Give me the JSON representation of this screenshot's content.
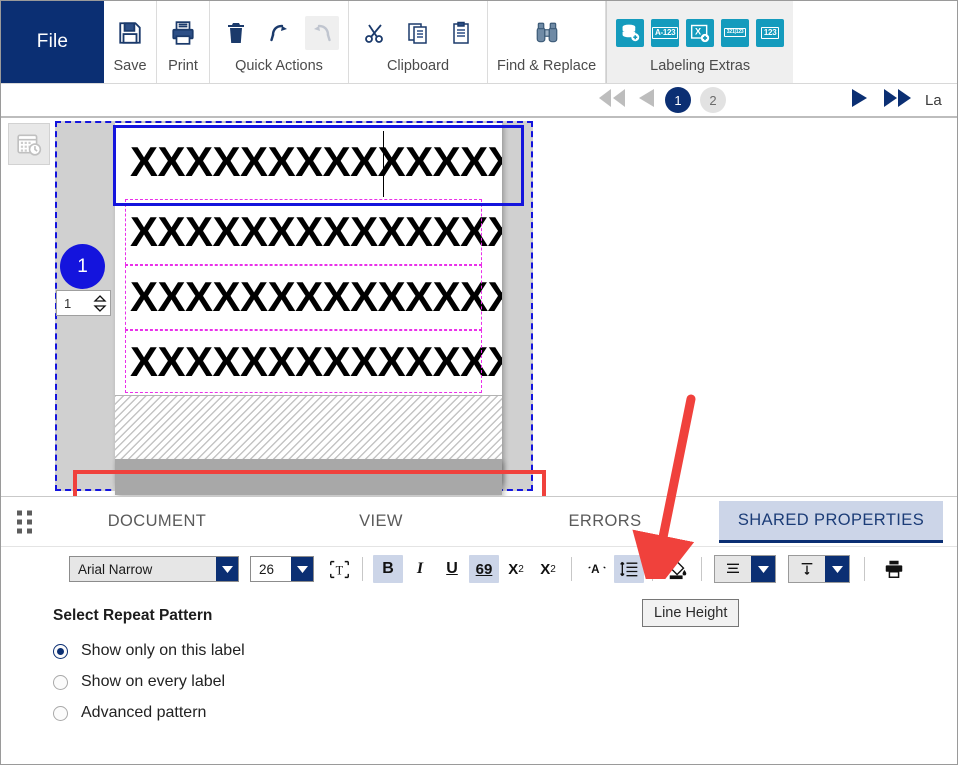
{
  "ribbon": {
    "file_label": "File",
    "groups": [
      {
        "label": "Save",
        "icons": [
          "floppy-disk-icon"
        ]
      },
      {
        "label": "Print",
        "icons": [
          "printer-icon"
        ]
      },
      {
        "label": "Quick Actions",
        "icons": [
          "trash-icon",
          "undo-icon",
          "redo-icon"
        ]
      },
      {
        "label": "Clipboard",
        "icons": [
          "scissors-icon",
          "copy-icon",
          "paste-icon"
        ]
      },
      {
        "label": "Find & Replace",
        "icons": [
          "binoculars-icon"
        ]
      },
      {
        "label": "Labeling Extras",
        "icons": [
          "database-add-icon",
          "alphanumeric-counter-icon",
          "object-add-icon",
          "mixed-text-icon",
          "number-counter-icon"
        ]
      }
    ],
    "extras_icon_texts": [
      "",
      "A-123",
      "X",
      "321|123",
      "123"
    ]
  },
  "navbar": {
    "first_page_label": "first-page",
    "prev_page_label": "previous-page",
    "pages": [
      {
        "number": "1",
        "active": true
      },
      {
        "number": "2",
        "active": false
      }
    ],
    "next_page_label": "next-page",
    "last_page_label": "last-page",
    "edge_text": "La"
  },
  "canvas": {
    "datetime_button": "date-time-insert",
    "object_badge": "1",
    "spinner_value": "1",
    "label_lines": [
      "XXXXXXXXXXXXXXXXX",
      "XXXXXXXXXXXXXXXXX",
      "XXXXXXXXXXXXXXXXX",
      "XXXXXXXXXXXXXXXXX"
    ]
  },
  "tabs": [
    {
      "label": "DOCUMENT",
      "active": false
    },
    {
      "label": "VIEW",
      "active": false
    },
    {
      "label": "ERRORS",
      "active": false
    },
    {
      "label": "SHARED PROPERTIES",
      "active": true
    }
  ],
  "format_toolbar": {
    "font_name": "Arial Narrow",
    "font_size": "26",
    "fit_text_label": "fit-text-to-box",
    "bold_label": "B",
    "italic_label": "I",
    "underline_label": "U",
    "strike_label": "69",
    "subscript_label": "X",
    "subscript_sub": "2",
    "superscript_label": "X",
    "superscript_sup": "2",
    "font_color_label": "A",
    "line_height_label": "line-height",
    "fill_color_label": "fill-color",
    "align_label": "text-align",
    "valign_label": "vertical-align",
    "print_label": "print"
  },
  "tooltip": {
    "text": "Line Height"
  },
  "repeat_pattern": {
    "title": "Select Repeat Pattern",
    "options": [
      {
        "label": "Show only on this label",
        "checked": true
      },
      {
        "label": "Show on every label",
        "checked": false
      },
      {
        "label": "Advanced pattern",
        "checked": false
      }
    ]
  },
  "colors": {
    "brand_navy": "#0b2f73",
    "teal": "#149bbd",
    "annotation_red": "#f0413c",
    "selection_blue": "#1414dd",
    "magenta_guide": "#ea2fea",
    "active_tab_bg": "#ccd5e8"
  }
}
